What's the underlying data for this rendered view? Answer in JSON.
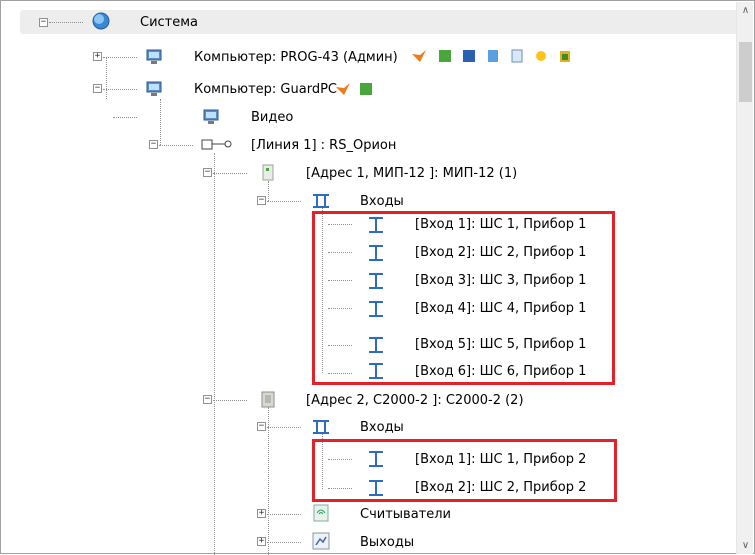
{
  "root": {
    "label": "Система",
    "toggle": "−"
  },
  "computers": [
    {
      "label": "Компьютер: PROG-43 (Админ)",
      "toggle": "+"
    },
    {
      "label": "Компьютер: GuardPC",
      "toggle": "−"
    }
  ],
  "video": {
    "label": "Видео"
  },
  "line": {
    "label": "[Линия 1] : RS_Орион",
    "toggle": "−"
  },
  "device1": {
    "label": "[Адрес 1, МИП-12 ]: МИП-12 (1)",
    "toggle": "−",
    "inputs_group": {
      "label": "Входы",
      "toggle": "−"
    },
    "inputs": [
      "[Вход 1]: ШС 1, Прибор 1",
      "[Вход 2]: ШС 2, Прибор 1",
      "[Вход 3]: ШС 3, Прибор 1",
      "[Вход 4]: ШС 4, Прибор 1",
      "[Вход 5]: ШС 5, Прибор 1",
      "[Вход 6]: ШС 6, Прибор 1"
    ]
  },
  "device2": {
    "label": "[Адрес 2, С2000-2 ]: С2000-2 (2)",
    "toggle": "−",
    "inputs_group": {
      "label": "Входы",
      "toggle": "−"
    },
    "inputs": [
      "[Вход 1]: ШС 1, Прибор 2",
      "[Вход 2]: ШС 2, Прибор 2"
    ],
    "readers": {
      "label": "Считыватели",
      "toggle": "+"
    },
    "outputs": {
      "label": "Выходы",
      "toggle": "+"
    }
  },
  "scroll": {
    "up": "∧",
    "down": "∨"
  },
  "colors": {
    "highlight": "#e3212b",
    "selection": "#ededed"
  }
}
